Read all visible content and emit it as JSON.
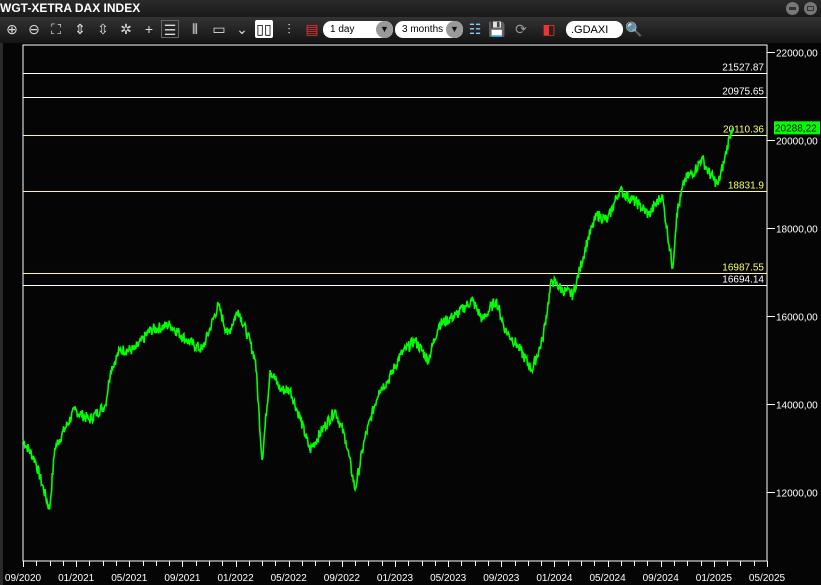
{
  "window": {
    "title": "WGT-XETRA DAX INDEX"
  },
  "toolbar": {
    "icons": [
      "zoom-in-icon",
      "zoom-out-icon",
      "zoom-fit-icon",
      "zoom-vertical-in-icon",
      "zoom-vertical-out-icon",
      "zoom-reset-icon",
      "crosshair-icon",
      "horizontal-grid-icon",
      "vertical-grid-icon",
      "window-icon",
      "line-chart-icon",
      "candlestick-icon",
      "bar-chart-icon",
      "legend-icon",
      "study-icon",
      "save-icon",
      "refresh-icon",
      "export-icon",
      "search-icon"
    ],
    "interval": "1 day",
    "range": "3 months",
    "symbol": ".GDAXI"
  },
  "colors": {
    "price": "#00ff00",
    "support": "#ffff66",
    "resistance": "#ffffff",
    "last_badge": "#00ff00"
  },
  "chart_data": {
    "type": "line",
    "title": "WGT-XETRA DAX INDEX",
    "ylim": [
      11000,
      22200
    ],
    "yticks": [
      "22000,00",
      "20000,00",
      "18000,00",
      "16000,00",
      "14000,00",
      "12000,00"
    ],
    "ytick_values": [
      22000,
      20000,
      18000,
      16000,
      14000,
      12000
    ],
    "xticks": [
      "09/2020",
      "01/2021",
      "05/2021",
      "09/2021",
      "01/2022",
      "05/2022",
      "09/2022",
      "01/2023",
      "05/2023",
      "09/2023",
      "01/2024",
      "05/2024",
      "09/2024",
      "01/2025",
      "05/2025"
    ],
    "x_start": "09/2020",
    "x_months_span": 56,
    "last_value": "20288,22",
    "levels": [
      {
        "label": "21527.87",
        "value": 21527.87,
        "color": "#ffffff"
      },
      {
        "label": "20975.65",
        "value": 20975.65,
        "color": "#ffffff"
      },
      {
        "label": "20110.36",
        "value": 20110.36,
        "color": "#ffff66"
      },
      {
        "label": "18831.9",
        "value": 18831.9,
        "color": "#ffff66"
      },
      {
        "label": "16987.55",
        "value": 16987.55,
        "color": "#ffff66"
      },
      {
        "label": "16694.14",
        "value": 16694.14,
        "color": "#ffffff"
      }
    ],
    "series": [
      {
        "name": ".GDAXI",
        "months": [
          0,
          0.9,
          2,
          2.4,
          3.9,
          5,
          6.2,
          6.6,
          7.3,
          8.4,
          9.6,
          11.1,
          12.3,
          13.5,
          14.7,
          15.4,
          16.2,
          16.9,
          17.5,
          18,
          18.6,
          19.4,
          20.1,
          20.9,
          21.6,
          22.5,
          23.5,
          24.3,
          25,
          25.7,
          26.8,
          27.5,
          28.4,
          29.5,
          30.5,
          31.3,
          32.6,
          33.8,
          34.6,
          35.6,
          36.3,
          37.2,
          38.3,
          39.1,
          39.8,
          40.6,
          41.4,
          41.9,
          42.5,
          43.2,
          44,
          44.9,
          46.4,
          47.1,
          48.1,
          48.9,
          49.2,
          49.8,
          50.6,
          51.1,
          51.5,
          52.3,
          52.8,
          53.2,
          53.4
        ],
        "values": [
          13180,
          12730,
          11600,
          13000,
          13860,
          13640,
          13980,
          14770,
          15230,
          15230,
          15680,
          15800,
          15450,
          15230,
          16250,
          15570,
          16140,
          15570,
          15000,
          12730,
          14770,
          14320,
          14320,
          13640,
          12950,
          13400,
          13860,
          13180,
          12050,
          13180,
          14320,
          14540,
          15110,
          15450,
          15000,
          15800,
          16020,
          16360,
          15910,
          16360,
          15680,
          15340,
          14770,
          15450,
          16820,
          16590,
          16480,
          17050,
          17730,
          18300,
          18180,
          18860,
          18520,
          18300,
          18750,
          17090,
          18300,
          19090,
          19320,
          19590,
          19320,
          18980,
          19550,
          20100,
          20288
        ]
      }
    ]
  }
}
